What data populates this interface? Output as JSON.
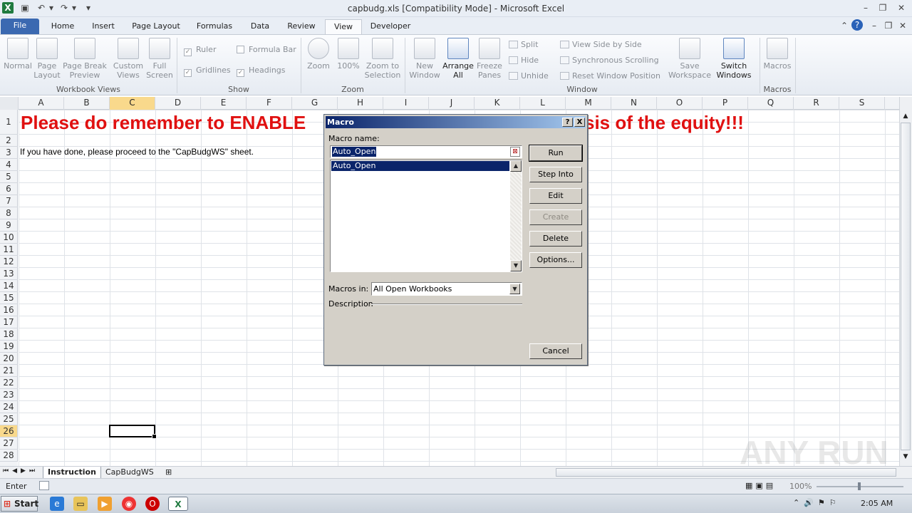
{
  "window": {
    "title": "capbudg.xls  [Compatibility Mode]  -  Microsoft Excel"
  },
  "ribbon_tabs": [
    "File",
    "Home",
    "Insert",
    "Page Layout",
    "Formulas",
    "Data",
    "Review",
    "View",
    "Developer"
  ],
  "ribbon": {
    "workbook_views": {
      "normal": "Normal",
      "page_layout": "Page Layout",
      "page_break_preview": "Page Break Preview",
      "custom_views": "Custom Views",
      "full_screen": "Full Screen",
      "group": "Workbook Views"
    },
    "show": {
      "ruler": "Ruler",
      "formula_bar": "Formula Bar",
      "gridlines": "Gridlines",
      "headings": "Headings",
      "group": "Show"
    },
    "zoom": {
      "zoom": "Zoom",
      "hundred": "100%",
      "zoom_selection": "Zoom to Selection",
      "group": "Zoom"
    },
    "window": {
      "new_window": "New Window",
      "arrange_all": "Arrange All",
      "freeze_panes": "Freeze Panes",
      "split": "Split",
      "hide": "Hide",
      "unhide": "Unhide",
      "view_side": "View Side by Side",
      "sync_scroll": "Synchronous Scrolling",
      "reset_pos": "Reset Window Position",
      "save_workspace": "Save Workspace",
      "switch_windows": "Switch Windows",
      "group": "Window"
    },
    "macros": {
      "macros": "Macros",
      "group": "Macros"
    }
  },
  "columns": [
    "A",
    "B",
    "C",
    "D",
    "E",
    "F",
    "G",
    "H",
    "I",
    "J",
    "K",
    "L",
    "M",
    "N",
    "O",
    "P",
    "Q",
    "R",
    "S"
  ],
  "rows": [
    "1",
    "2",
    "3",
    "4",
    "5",
    "6",
    "7",
    "8",
    "9",
    "10",
    "11",
    "12",
    "13",
    "14",
    "15",
    "16",
    "17",
    "18",
    "19",
    "20",
    "21",
    "22",
    "23",
    "24",
    "25",
    "26",
    "27",
    "28"
  ],
  "cells": {
    "a1_left": "Please do remember to ENABLE",
    "a1_right": "sis of the equity!!!",
    "a3": "If you have done, please proceed to the \"CapBudgWS\" sheet."
  },
  "sheets": [
    "Instruction",
    "CapBudgWS"
  ],
  "status": {
    "mode": "Enter",
    "zoom": "100%"
  },
  "taskbar": {
    "start": "Start",
    "time": "2:05 AM"
  },
  "dialog": {
    "title": "Macro",
    "help": "?",
    "close": "X",
    "macro_name_label": "Macro name:",
    "macro_name_value": "Auto_Open",
    "macro_list": [
      "Auto_Open"
    ],
    "buttons": {
      "run": "Run",
      "step_into": "Step Into",
      "edit": "Edit",
      "create": "Create",
      "delete": "Delete",
      "options": "Options...",
      "cancel": "Cancel"
    },
    "macros_in_label": "Macros in:",
    "macros_in_value": "All Open Workbooks",
    "description_label": "Description"
  },
  "watermark": "ANY RUN",
  "colors": {
    "accent": "#3b69b1",
    "heading_red": "#e01010",
    "dialog_title": "#0a246a",
    "selection": "#0a246a"
  }
}
